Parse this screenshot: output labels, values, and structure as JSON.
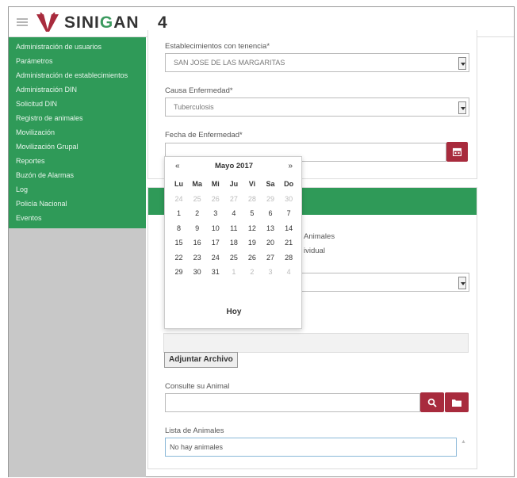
{
  "header": {
    "brand_pre": "SINI",
    "brand_g": "G",
    "brand_post": "AN",
    "brand_number": "4",
    "logo_color": "#a82b3d"
  },
  "sidebar": {
    "items": [
      {
        "label": "Administración de usuarios"
      },
      {
        "label": "Parámetros"
      },
      {
        "label": "Administración de establecimientos"
      },
      {
        "label": "Administración DIN"
      },
      {
        "label": "Solicitud DIN"
      },
      {
        "label": "Registro de animales"
      },
      {
        "label": "Movilización"
      },
      {
        "label": "Movilización Grupal"
      },
      {
        "label": "Reportes"
      },
      {
        "label": "Buzón de Alarmas"
      },
      {
        "label": "Log"
      },
      {
        "label": "Policía Nacional"
      },
      {
        "label": "Eventos"
      }
    ]
  },
  "form": {
    "establecimiento_label": "Establecimientos con tenencia*",
    "establecimiento_value": "SAN JOSE DE LAS MARGARITAS",
    "causa_label": "Causa Enfermedad*",
    "causa_value": "Tuberculosis",
    "fecha_label": "Fecha de Enfermedad*",
    "fecha_value": "",
    "behind_text_1": "Animales",
    "behind_text_2": "ividual",
    "attach_label": "Adjuntar Archivo",
    "consulte_label": "Consulte su Animal",
    "consulte_value": "",
    "lista_label": "Lista de Animales",
    "lista_value": "No hay animales"
  },
  "datepicker": {
    "prev": "«",
    "next": "»",
    "title": "Mayo 2017",
    "days_of_week": [
      "Lu",
      "Ma",
      "Mi",
      "Ju",
      "Vi",
      "Sa",
      "Do"
    ],
    "weeks": [
      [
        {
          "d": "24",
          "m": true
        },
        {
          "d": "25",
          "m": true
        },
        {
          "d": "26",
          "m": true
        },
        {
          "d": "27",
          "m": true
        },
        {
          "d": "28",
          "m": true
        },
        {
          "d": "29",
          "m": true
        },
        {
          "d": "30",
          "m": true
        }
      ],
      [
        {
          "d": "1",
          "m": false
        },
        {
          "d": "2",
          "m": false
        },
        {
          "d": "3",
          "m": false
        },
        {
          "d": "4",
          "m": false
        },
        {
          "d": "5",
          "m": false
        },
        {
          "d": "6",
          "m": false
        },
        {
          "d": "7",
          "m": false
        }
      ],
      [
        {
          "d": "8",
          "m": false
        },
        {
          "d": "9",
          "m": false
        },
        {
          "d": "10",
          "m": false
        },
        {
          "d": "11",
          "m": false
        },
        {
          "d": "12",
          "m": false
        },
        {
          "d": "13",
          "m": false
        },
        {
          "d": "14",
          "m": false
        }
      ],
      [
        {
          "d": "15",
          "m": false
        },
        {
          "d": "16",
          "m": false
        },
        {
          "d": "17",
          "m": false
        },
        {
          "d": "18",
          "m": false
        },
        {
          "d": "19",
          "m": false
        },
        {
          "d": "20",
          "m": false
        },
        {
          "d": "21",
          "m": false
        }
      ],
      [
        {
          "d": "22",
          "m": false
        },
        {
          "d": "23",
          "m": false
        },
        {
          "d": "24",
          "m": false
        },
        {
          "d": "25",
          "m": false
        },
        {
          "d": "26",
          "m": false
        },
        {
          "d": "27",
          "m": false
        },
        {
          "d": "28",
          "m": false
        }
      ],
      [
        {
          "d": "29",
          "m": false
        },
        {
          "d": "30",
          "m": false
        },
        {
          "d": "31",
          "m": false
        },
        {
          "d": "1",
          "m": true
        },
        {
          "d": "2",
          "m": true
        },
        {
          "d": "3",
          "m": true
        },
        {
          "d": "4",
          "m": true
        }
      ]
    ],
    "today_label": "Hoy"
  },
  "colors": {
    "sidebar_green": "#2f9a58",
    "action_red": "#a82b3d"
  }
}
